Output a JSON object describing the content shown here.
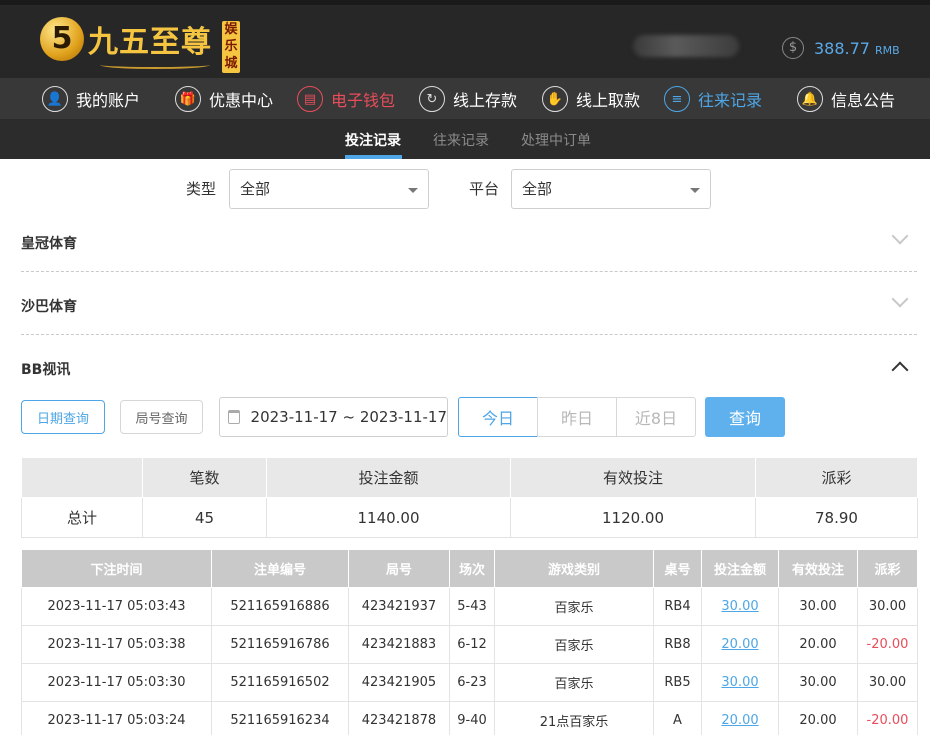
{
  "brand": {
    "logo_mark": "5",
    "name": "九五至尊",
    "tag": "娱乐城"
  },
  "account": {
    "username_masked": "",
    "balance": "388.77",
    "currency": "RMB",
    "coin_icon": "dollar-coin-icon"
  },
  "nav": [
    {
      "label": "我的账户",
      "icon": "user-icon",
      "glyph": "👤"
    },
    {
      "label": "优惠中心",
      "icon": "gift-icon",
      "glyph": "🎁"
    },
    {
      "label": "电子钱包",
      "icon": "wallet-icon",
      "glyph": "▤"
    },
    {
      "label": "线上存款",
      "icon": "deposit-icon",
      "glyph": "↻"
    },
    {
      "label": "线上取款",
      "icon": "withdraw-icon",
      "glyph": "✋"
    },
    {
      "label": "往来记录",
      "icon": "records-icon",
      "glyph": "≡"
    },
    {
      "label": "信息公告",
      "icon": "bell-icon",
      "glyph": "🔔"
    }
  ],
  "subnav": [
    "投注记录",
    "往来记录",
    "处理中订单"
  ],
  "filters": {
    "type_label": "类型",
    "type_value": "全部",
    "platform_label": "平台",
    "platform_value": "全部"
  },
  "sections": [
    "皇冠体育",
    "沙巴体育",
    "BB视讯"
  ],
  "query": {
    "date_query": "日期查询",
    "round_query": "局号查询",
    "date_range": "2023-11-17 ~ 2023-11-17",
    "today": "今日",
    "yesterday": "昨日",
    "last8": "近8日",
    "submit": "查询"
  },
  "summary": {
    "headers": [
      "",
      "笔数",
      "投注金额",
      "有效投注",
      "派彩"
    ],
    "row": [
      "总计",
      "45",
      "1140.00",
      "1120.00",
      "78.90"
    ]
  },
  "detail": {
    "headers": [
      "下注时间",
      "注单编号",
      "局号",
      "场次",
      "游戏类别",
      "桌号",
      "投注金额",
      "有效投注",
      "派彩"
    ],
    "rows": [
      [
        "2023-11-17 05:03:43",
        "521165916886",
        "423421937",
        "5-43",
        "百家乐",
        "RB4",
        "30.00",
        "30.00",
        "30.00"
      ],
      [
        "2023-11-17 05:03:38",
        "521165916786",
        "423421883",
        "6-12",
        "百家乐",
        "RB8",
        "20.00",
        "20.00",
        "-20.00"
      ],
      [
        "2023-11-17 05:03:30",
        "521165916502",
        "423421905",
        "6-23",
        "百家乐",
        "RB5",
        "30.00",
        "30.00",
        "30.00"
      ],
      [
        "2023-11-17 05:03:24",
        "521165916234",
        "423421878",
        "9-40",
        "21点百家乐",
        "A",
        "20.00",
        "20.00",
        "-20.00"
      ]
    ]
  },
  "colors": {
    "accent": "#4ea6e6",
    "negative": "#e84d5b",
    "header_bg": "#272727",
    "nav_bg": "#383838"
  }
}
